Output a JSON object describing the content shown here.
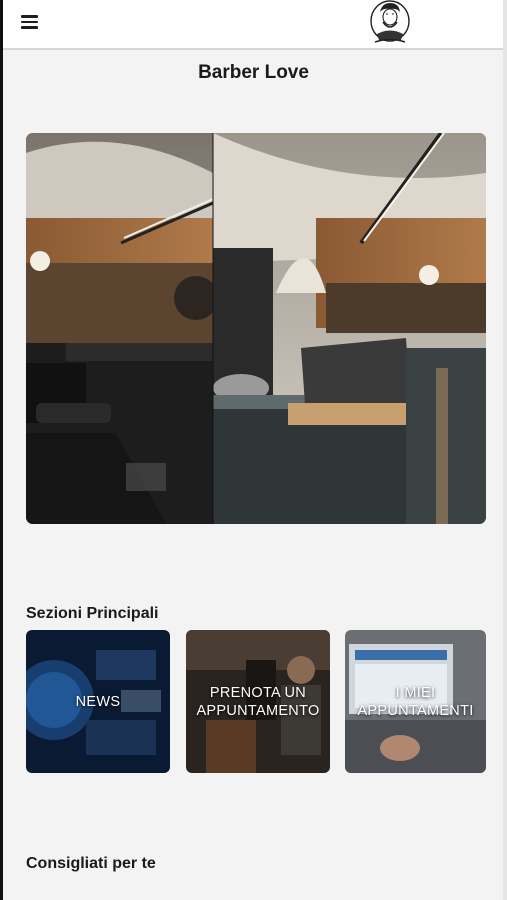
{
  "app": {
    "title": "Barber Love",
    "menu_icon": "hamburger-menu-icon",
    "logo_icon": "barber-logo-icon"
  },
  "hero": {
    "image": "barbershop-interior-photo"
  },
  "sections": {
    "main_title": "Sezioni Principali",
    "tiles": [
      {
        "label": "NEWS",
        "image": "news-world-map-photo"
      },
      {
        "label": "PRENOTA UN\nAPPUNTAMENTO",
        "image": "barber-at-work-photo"
      },
      {
        "label": "I MIEI\nAPPUNTAMENTI",
        "image": "laptop-calendar-photo"
      }
    ],
    "recommended_title": "Consigliati per te"
  },
  "colors": {
    "background": "#f3f3f3",
    "topbar": "#ffffff",
    "text": "#1a1a1a"
  }
}
